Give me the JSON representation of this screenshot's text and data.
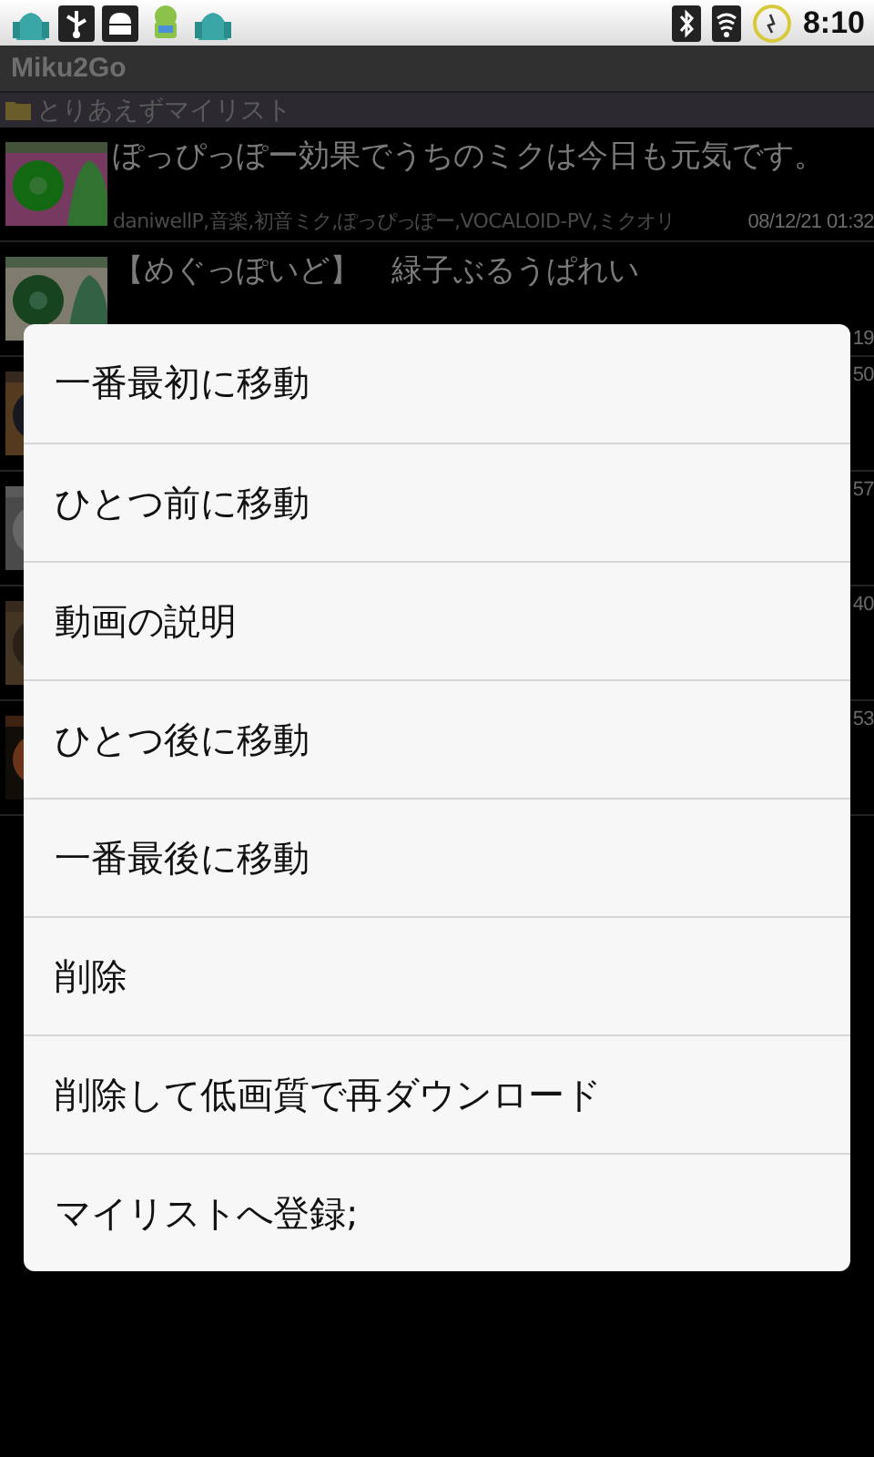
{
  "status_bar": {
    "time": "8:10"
  },
  "app": {
    "title": "Miku2Go"
  },
  "mylist": {
    "name": "とりあえずマイリスト"
  },
  "videos": [
    {
      "title": "ぽっぴっぽー効果でうちのミクは今日も元気です。",
      "meta": "daniwellP,音楽,初音ミク,ぽっぴっぽー,VOCALOID-PV,ミクオリ",
      "date": "08/12/21 01:32"
    },
    {
      "title": "【めぐっぽいど】　緑子ぶるうぱれい",
      "date": "19"
    },
    {
      "date": "50"
    },
    {
      "date": "57"
    },
    {
      "date": "40"
    },
    {
      "date": "53"
    }
  ],
  "context_menu": {
    "items": [
      "一番最初に移動",
      "ひとつ前に移動",
      "動画の説明",
      "ひとつ後に移動",
      "一番最後に移動",
      "削除",
      "削除して低画質で再ダウンロード",
      "マイリストへ登録;"
    ]
  }
}
